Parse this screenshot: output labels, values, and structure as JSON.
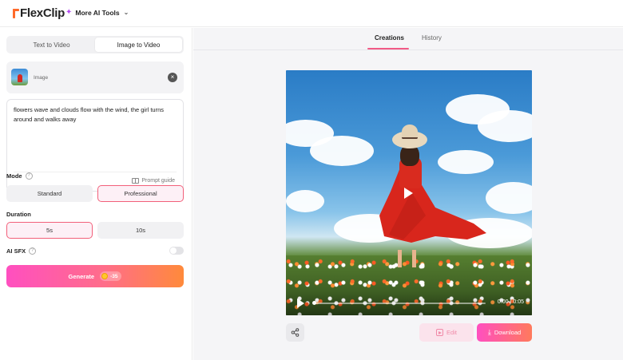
{
  "header": {
    "logo_text": "FlexClip",
    "more_tools_label": "More AI Tools"
  },
  "left_panel": {
    "tabs": [
      {
        "label": "Text to Video",
        "active": false
      },
      {
        "label": "Image to Video",
        "active": true
      }
    ],
    "image_card": {
      "label": "Image"
    },
    "prompt": {
      "text": "flowers wave and clouds flow with the wind, the girl turns around and walks away",
      "guide_label": "Prompt guide"
    },
    "mode": {
      "label": "Mode",
      "options": [
        {
          "label": "Standard",
          "selected": false
        },
        {
          "label": "Professional",
          "selected": true
        }
      ]
    },
    "duration": {
      "label": "Duration",
      "options": [
        {
          "label": "5s",
          "selected": true
        },
        {
          "label": "10s",
          "selected": false
        }
      ]
    },
    "ai_sfx": {
      "label": "AI SFX",
      "enabled": false
    },
    "generate": {
      "label": "Generate",
      "credits": "-35"
    }
  },
  "right_panel": {
    "tabs": [
      {
        "label": "Creations",
        "active": true
      },
      {
        "label": "History",
        "active": false
      }
    ],
    "video": {
      "time": "0:00 / 0:05",
      "progress": 0.0
    },
    "actions": {
      "edit_label": "Edit",
      "download_label": "Download"
    }
  },
  "colors": {
    "accent_pink": "#f15a86",
    "gradient_start": "#ff4fc0",
    "gradient_end": "#ff8a3b",
    "logo_orange": "#ff6a2a"
  }
}
